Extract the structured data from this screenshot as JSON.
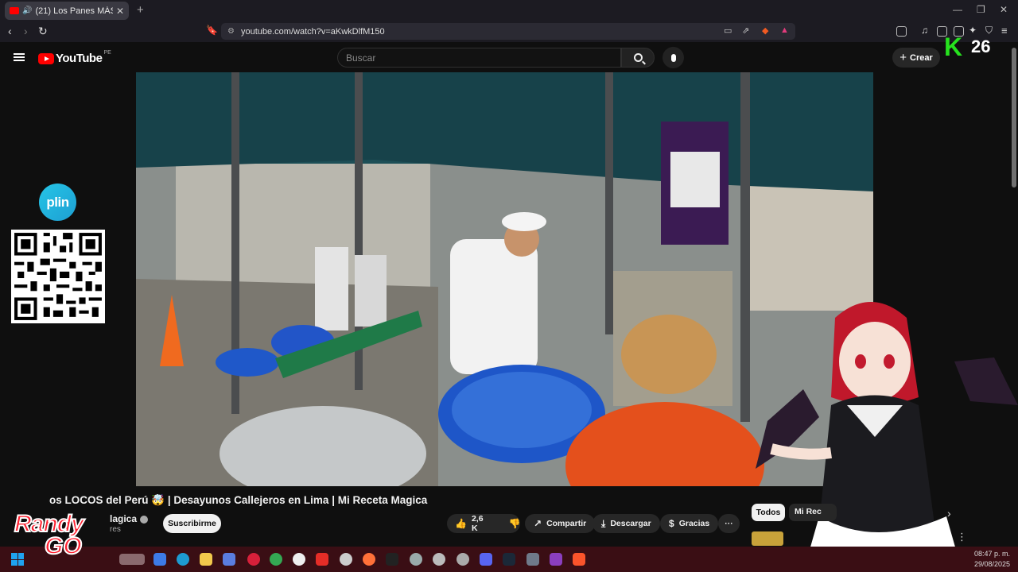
{
  "browser": {
    "tab_title": "(21) Los Panes MÁS LOCOS d",
    "url": "youtube.com/watch?v=aKwkDlfM150"
  },
  "header": {
    "logo_text": "YouTube",
    "country_code": "PE",
    "search_placeholder": "Buscar",
    "create_label": "Crear"
  },
  "video": {
    "title": "os LOCOS del Perú 🤯 | Desayunos Callejeros en Lima | Mi Receta Magica",
    "channel_name": "lagica",
    "subscriber_text": "res",
    "subscribe_label": "Suscribirme",
    "like_count": "2,6 K",
    "share_label": "Compartir",
    "download_label": "Descargar",
    "thanks_label": "Gracias",
    "more_label": "···"
  },
  "sidebar_chips": [
    "Todos",
    "Mi Rec"
  ],
  "overlay": {
    "plin_label": "plin",
    "badge_letter": "K",
    "badge_number": "26",
    "streamer_logo_top": "Randy",
    "streamer_logo_bottom": "GO"
  },
  "taskbar": {
    "time": "08:47 p. m.",
    "date": "29/08/2025"
  },
  "colors": {
    "youtube_red": "#ff0000",
    "taskbar_bg": "#3a0e14",
    "plin_blue": "#1d9fd3",
    "badge_green": "#26e11e"
  }
}
